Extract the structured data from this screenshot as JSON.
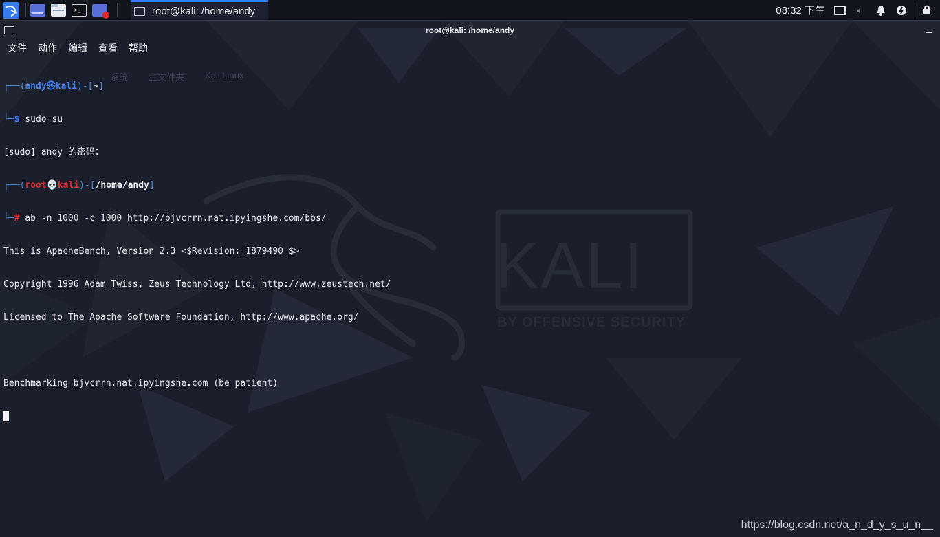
{
  "panel": {
    "task_title": "root@kali: /home/andy",
    "clock": "08:32 下午",
    "launcher_icon": "kali-dragon-icon",
    "quick_icons": [
      "workspace-switcher-icon",
      "file-manager-icon",
      "terminal-icon",
      "screen-recorder-icon"
    ],
    "tray_icons": [
      "display-icon",
      "volume-icon",
      "notifications-icon",
      "power-icon",
      "lock-icon"
    ]
  },
  "window": {
    "title": "root@kali: /home/andy",
    "menu": [
      "文件",
      "动作",
      "编辑",
      "查看",
      "帮助"
    ]
  },
  "terminal": {
    "prompt1": {
      "tree_top": "┌──(",
      "user": "andy",
      "sep": "㉿",
      "host": "kali",
      "close": ")-[",
      "dir": "~",
      "end": "]"
    },
    "cmd1": {
      "tree": "└─",
      "sym": "$",
      "text": " sudo su"
    },
    "sudo_line": "[sudo] andy 的密码：",
    "prompt2": {
      "tree_top": "┌──(",
      "user": "root",
      "sep": "💀",
      "host": "kali",
      "close": ")-[",
      "dir": "/home/andy",
      "end": "]"
    },
    "cmd2": {
      "tree": "└─",
      "sym": "#",
      "text": " ab -n 1000 -c 1000 http://bjvcrrn.nat.ipyingshe.com/bbs/"
    },
    "output": [
      "This is ApacheBench, Version 2.3 <$Revision: 1879490 $>",
      "Copyright 1996 Adam Twiss, Zeus Technology Ltd, http://www.zeustech.net/",
      "Licensed to The Apache Software Foundation, http://www.apache.org/",
      "",
      "Benchmarking bjvcrrn.nat.ipyingshe.com (be patient)"
    ]
  },
  "wallpaper": {
    "brand": "KALI",
    "tagline": "BY OFFENSIVE SECURITY",
    "ghost_labels": [
      "系统",
      "主文件夹",
      "Kali Linux"
    ]
  },
  "watermark": "https://blog.csdn.net/a_n_d_y_s_u_n__",
  "colors": {
    "accent": "#367bf0",
    "prompt_user": "#3f7ff3",
    "root_red": "#e0272b",
    "background": "#1b1f2b"
  }
}
